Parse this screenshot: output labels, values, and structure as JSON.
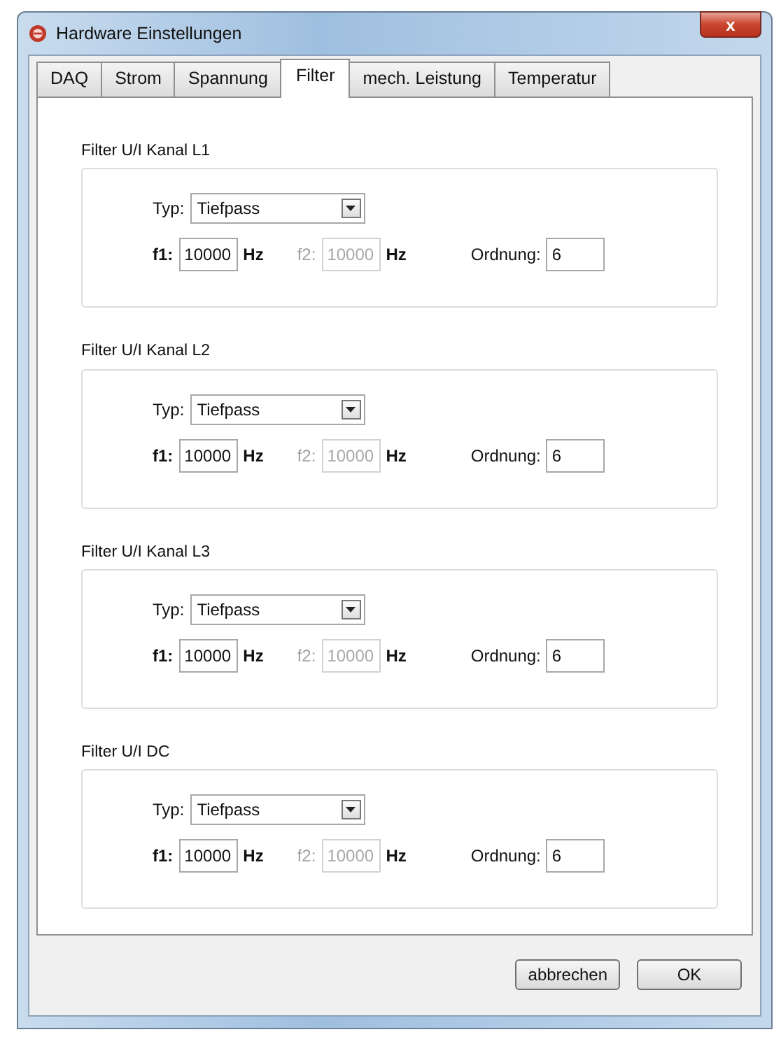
{
  "window": {
    "title": "Hardware Einstellungen",
    "close": "x"
  },
  "tabs": [
    {
      "label": "DAQ",
      "selected": false
    },
    {
      "label": "Strom",
      "selected": false
    },
    {
      "label": "Spannung",
      "selected": false
    },
    {
      "label": "Filter",
      "selected": true
    },
    {
      "label": "mech. Leistung",
      "selected": false
    },
    {
      "label": "Temperatur",
      "selected": false
    }
  ],
  "groups": [
    {
      "title": "Filter U/I Kanal L1",
      "type_label": "Typ:",
      "type_value": "Tiefpass",
      "fields": [
        {
          "label": "f1:",
          "value": "10000",
          "unit": "Hz",
          "disabled": false
        },
        {
          "label": "f2:",
          "value": "10000",
          "unit": "Hz",
          "disabled": true
        }
      ],
      "order_label": "Ordnung:",
      "order_value": "6"
    },
    {
      "title": "Filter U/I Kanal L2",
      "type_label": "Typ:",
      "type_value": "Tiefpass",
      "fields": [
        {
          "label": "f1:",
          "value": "10000",
          "unit": "Hz",
          "disabled": false
        },
        {
          "label": "f2:",
          "value": "10000",
          "unit": "Hz",
          "disabled": true
        }
      ],
      "order_label": "Ordnung:",
      "order_value": "6"
    },
    {
      "title": "Filter U/I Kanal L3",
      "type_label": "Typ:",
      "type_value": "Tiefpass",
      "fields": [
        {
          "label": "f1:",
          "value": "10000",
          "unit": "Hz",
          "disabled": false
        },
        {
          "label": "f2:",
          "value": "10000",
          "unit": "Hz",
          "disabled": true
        }
      ],
      "order_label": "Ordnung:",
      "order_value": "6"
    },
    {
      "title": "Filter U/I DC",
      "type_label": "Typ:",
      "type_value": "Tiefpass",
      "fields": [
        {
          "label": "f1:",
          "value": "10000",
          "unit": "Hz",
          "disabled": false
        },
        {
          "label": "f2:",
          "value": "10000",
          "unit": "Hz",
          "disabled": true
        }
      ],
      "order_label": "Ordnung:",
      "order_value": "6"
    }
  ],
  "buttons": [
    "abbrechen",
    "OK"
  ]
}
